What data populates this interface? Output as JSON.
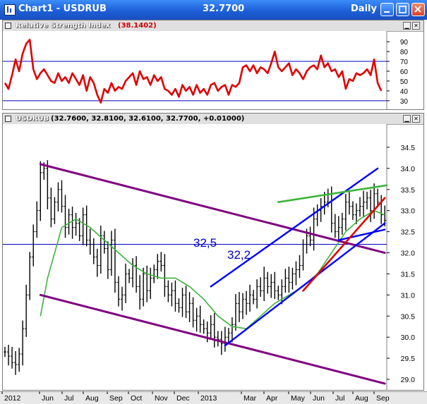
{
  "window": {
    "title": "Chart1 - USDRUB",
    "price": "32.7700",
    "period": "Daily"
  },
  "rsi_pane": {
    "name": "Relative Strength Index",
    "value": "(38.1402)"
  },
  "price_pane": {
    "name": "USDRUB",
    "ohlc": "(32.7600, 32.8100, 32.6100, 32.7700, +0.01000)"
  },
  "colors": {
    "rsi_line": "#e00000",
    "price_bars": "#000000",
    "moving_average": "#3cb43c",
    "channel": "#800080",
    "trend_blue": "#0000ff",
    "trend_red": "#e00000",
    "trend_green": "#3cb43c"
  },
  "chart_data": [
    {
      "type": "line",
      "title": "Relative Strength Index",
      "y_ticks": [
        30,
        40,
        50,
        60,
        70,
        80,
        90
      ],
      "ylim": [
        22,
        98
      ],
      "reference_lines": [
        30,
        70
      ],
      "series": [
        {
          "name": "Relative Strength Index",
          "x": [
            0,
            5,
            10,
            15,
            20,
            25,
            30,
            35,
            40,
            45,
            50,
            55,
            60,
            65,
            70,
            75,
            80,
            85,
            90,
            95,
            100,
            105,
            110,
            115,
            120,
            125,
            130,
            135,
            140,
            145,
            150,
            155,
            160,
            165,
            170,
            175,
            180,
            185,
            190,
            195,
            200,
            205,
            210,
            215,
            220,
            225,
            230,
            235,
            240,
            245,
            250,
            255,
            260,
            265,
            270,
            275,
            280,
            285,
            290,
            295,
            300,
            305,
            310,
            315,
            320,
            325,
            330,
            335,
            340,
            345,
            350,
            355,
            360,
            365,
            370,
            375,
            380,
            385,
            390,
            395,
            400,
            405,
            410,
            415,
            420,
            425,
            430,
            435,
            440,
            445,
            450,
            455,
            460,
            465,
            470,
            475,
            480,
            485,
            490,
            495,
            500,
            505,
            510,
            515,
            520,
            525,
            530
          ],
          "y": [
            48,
            42,
            56,
            72,
            60,
            78,
            88,
            92,
            62,
            52,
            58,
            62,
            56,
            50,
            48,
            58,
            50,
            54,
            48,
            58,
            52,
            46,
            56,
            40,
            54,
            48,
            36,
            28,
            42,
            38,
            48,
            40,
            44,
            42,
            50,
            54,
            58,
            46,
            60,
            52,
            54,
            46,
            56,
            50,
            54,
            42,
            40,
            36,
            42,
            34,
            46,
            40,
            44,
            36,
            46,
            38,
            42,
            36,
            46,
            48,
            40,
            44,
            46,
            36,
            46,
            44,
            48,
            64,
            66,
            60,
            66,
            58,
            64,
            62,
            58,
            68,
            80,
            64,
            60,
            64,
            68,
            56,
            62,
            58,
            52,
            60,
            64,
            66,
            62,
            76,
            64,
            68,
            60,
            62,
            54,
            60,
            42,
            52,
            50,
            58,
            56,
            58,
            62,
            56,
            72,
            48,
            40
          ]
        }
      ]
    },
    {
      "type": "bar",
      "title": "USDRUB",
      "x_tick_labels": [
        "2012",
        "Jun",
        "Jul",
        "Aug",
        "Sep",
        "Oct",
        "Nov",
        "Dec",
        "2013",
        "Mar",
        "Apr",
        "May",
        "Jun",
        "Jul",
        "Aug",
        "Sep"
      ],
      "y_ticks": [
        "29.0",
        "29.5",
        "30.0",
        "30.5",
        "31.0",
        "31.5",
        "32.0",
        "32.5",
        "33.0",
        "33.5",
        "34.0",
        "34.5"
      ],
      "ylim": [
        28.8,
        34.95
      ],
      "annotations": [
        "32,5",
        "32,2"
      ],
      "horizontal_line": 32.2,
      "series": [
        {
          "name": "USDRUB",
          "x": [
            0,
            5,
            10,
            15,
            20,
            25,
            30,
            35,
            40,
            45,
            50,
            55,
            60,
            65,
            70,
            75,
            80,
            85,
            90,
            95,
            100,
            105,
            110,
            115,
            120,
            125,
            130,
            135,
            140,
            145,
            150,
            155,
            160,
            165,
            170,
            175,
            180,
            185,
            190,
            195,
            200,
            205,
            210,
            215,
            220,
            225,
            230,
            235,
            240,
            245,
            250,
            255,
            260,
            265,
            270,
            275,
            280,
            285,
            290,
            295,
            300,
            305,
            310,
            315,
            320,
            325,
            330,
            335,
            340,
            345,
            350,
            355,
            360,
            365,
            370,
            375,
            380,
            385,
            390,
            395,
            400,
            405,
            410,
            415,
            420,
            425,
            430,
            435,
            440,
            445,
            450,
            455,
            460,
            465,
            470,
            475,
            480,
            485,
            490,
            495,
            500,
            505,
            510,
            515,
            520,
            525,
            530,
            535
          ],
          "close": [
            29.65,
            29.55,
            29.4,
            29.35,
            29.6,
            30.2,
            31.0,
            31.9,
            32.5,
            33.0,
            33.9,
            34.0,
            33.3,
            32.8,
            33.2,
            33.5,
            33.1,
            32.6,
            32.9,
            32.6,
            32.7,
            32.4,
            32.9,
            32.3,
            32.2,
            31.9,
            31.7,
            32.4,
            32.1,
            31.6,
            32.3,
            31.3,
            30.9,
            31.0,
            31.5,
            31.4,
            31.7,
            31.2,
            30.9,
            31.5,
            31.1,
            31.4,
            31.6,
            31.8,
            31.7,
            31.2,
            31.0,
            31.1,
            30.8,
            30.7,
            31.0,
            30.6,
            30.8,
            30.4,
            30.5,
            30.3,
            30.2,
            30.1,
            30.3,
            30.0,
            29.95,
            29.85,
            30.0,
            30.1,
            30.3,
            30.8,
            30.6,
            30.9,
            30.8,
            31.0,
            30.9,
            31.2,
            31.1,
            31.4,
            31.2,
            31.3,
            31.1,
            31.0,
            31.2,
            31.4,
            31.3,
            31.5,
            31.6,
            31.7,
            32.2,
            32.4,
            32.3,
            32.8,
            33.0,
            33.1,
            33.2,
            33.4,
            32.7,
            32.5,
            32.6,
            32.8,
            33.2,
            33.1,
            32.9,
            33.0,
            33.1,
            33.2,
            33.3,
            33.0,
            33.4,
            33.2,
            32.9,
            32.77
          ]
        },
        {
          "name": "",
          "x": [
            50,
            60,
            80,
            100,
            120,
            140,
            160,
            180,
            200,
            220,
            240,
            260,
            280,
            300,
            320,
            340,
            360,
            380,
            400,
            420,
            440,
            460,
            480,
            500,
            520,
            535
          ],
          "y": [
            30.5,
            31.4,
            32.6,
            32.8,
            32.6,
            32.3,
            32.0,
            31.7,
            31.5,
            31.4,
            31.4,
            31.2,
            30.9,
            30.5,
            30.25,
            30.2,
            30.5,
            30.8,
            31.0,
            31.2,
            31.5,
            32.0,
            32.5,
            32.8,
            33.0,
            32.9
          ]
        }
      ],
      "trend_lines": [
        {
          "color": "purple",
          "from": [
            50,
            34.1
          ],
          "to": [
            535,
            32.0
          ]
        },
        {
          "color": "purple",
          "from": [
            50,
            31.0
          ],
          "to": [
            535,
            28.9
          ]
        },
        {
          "color": "blue",
          "from": [
            310,
            29.8
          ],
          "to": [
            535,
            32.7
          ]
        },
        {
          "color": "blue",
          "from": [
            290,
            31.2
          ],
          "to": [
            525,
            34.0
          ]
        },
        {
          "color": "blue",
          "from": [
            470,
            32.3
          ],
          "to": [
            535,
            32.55
          ]
        },
        {
          "color": "red",
          "from": [
            420,
            31.1
          ],
          "to": [
            535,
            33.3
          ]
        },
        {
          "color": "green",
          "from": [
            385,
            33.2
          ],
          "to": [
            550,
            33.6
          ]
        }
      ]
    }
  ]
}
